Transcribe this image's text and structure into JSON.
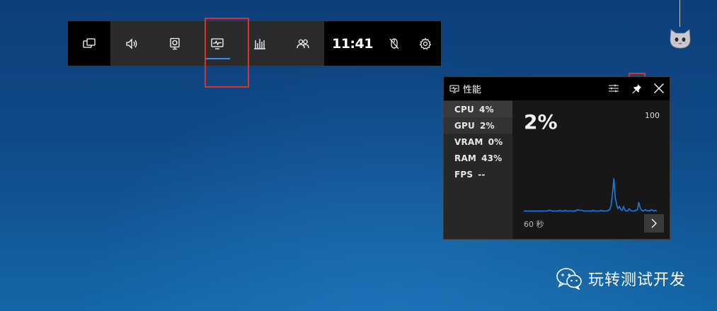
{
  "gamebar": {
    "clock": "11:41",
    "widgets": [
      {
        "name": "widget-menu-icon"
      },
      {
        "name": "audio-icon"
      },
      {
        "name": "capture-icon"
      },
      {
        "name": "performance-icon"
      },
      {
        "name": "resources-icon"
      },
      {
        "name": "social-icon"
      }
    ],
    "active_widget": "performance",
    "active_color": "#2d8cff"
  },
  "performance": {
    "title": "性能",
    "metrics": [
      {
        "label": "CPU",
        "value": "4%"
      },
      {
        "label": "GPU",
        "value": "2%"
      },
      {
        "label": "VRAM",
        "value": "0%"
      },
      {
        "label": "RAM",
        "value": "43%"
      },
      {
        "label": "FPS",
        "value": "--"
      }
    ],
    "current_value": "2%",
    "max_value": "100",
    "duration": "60 秒",
    "graph_color": "#1b7be0",
    "graph_series": [
      3,
      3,
      3,
      3,
      3,
      3,
      3,
      3,
      3,
      3,
      3,
      3,
      3,
      3,
      3,
      3,
      3,
      3,
      4,
      4,
      3,
      3,
      3,
      3,
      3,
      3,
      4,
      3,
      3,
      3,
      4,
      3,
      3,
      3,
      3,
      3,
      3,
      3,
      4,
      5,
      4,
      4,
      4,
      3,
      3,
      3,
      3,
      3,
      3,
      3,
      4,
      3,
      3,
      3,
      3,
      3,
      4,
      3,
      3,
      3,
      3,
      4,
      5,
      10,
      25,
      44,
      20,
      11,
      6,
      9,
      5,
      4,
      9,
      4,
      3,
      3,
      6,
      4,
      3,
      3,
      3,
      4,
      5,
      14,
      7,
      4,
      3,
      4,
      5,
      3,
      4,
      3,
      5,
      4,
      3,
      4,
      3
    ]
  },
  "watermark": {
    "text": "玩转测试开发"
  }
}
